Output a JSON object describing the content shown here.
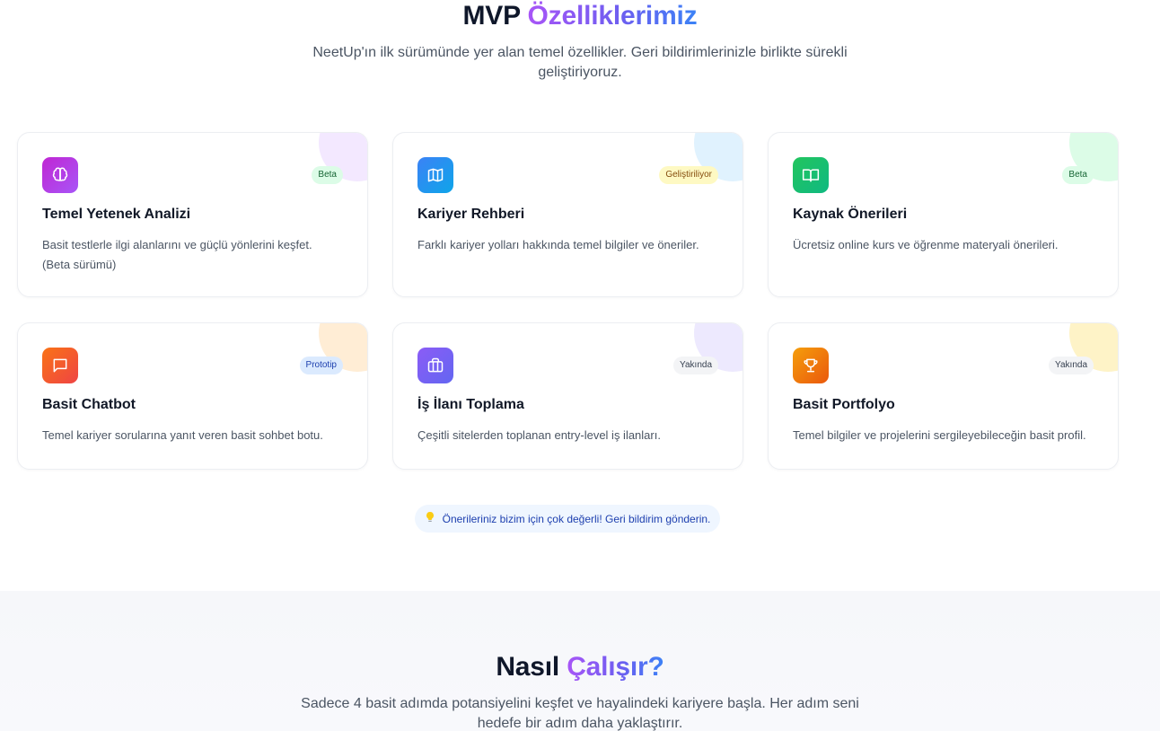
{
  "features": {
    "title_plain": "MVP",
    "title_accent": "Özelliklerimiz",
    "subtitle": "NeetUp'ın ilk sürümünde yer alan temel özellikler. Geri bildirimlerinizle birlikte sürekli geliştiriyoruz.",
    "cards": [
      {
        "title": "Temel Yetenek Analizi",
        "desc": "Basit testlerle ilgi alanlarını ve güçlü yönlerini keşfet. (Beta sürümü)",
        "badge": "Beta",
        "icon": "brain-icon"
      },
      {
        "title": "Kariyer Rehberi",
        "desc": "Farklı kariyer yolları hakkında temel bilgiler ve öneriler.",
        "badge": "Geliştiriliyor",
        "icon": "map-icon"
      },
      {
        "title": "Kaynak Önerileri",
        "desc": "Ücretsiz online kurs ve öğrenme materyali önerileri.",
        "badge": "Beta",
        "icon": "book-icon"
      },
      {
        "title": "Basit Chatbot",
        "desc": "Temel kariyer sorularına yanıt veren basit sohbet botu.",
        "badge": "Prototip",
        "icon": "chat-icon"
      },
      {
        "title": "İş İlanı Toplama",
        "desc": "Çeşitli sitelerden toplanan entry-level iş ilanları.",
        "badge": "Yakında",
        "icon": "briefcase-icon"
      },
      {
        "title": "Basit Portfolyo",
        "desc": "Temel bilgiler ve projelerini sergileyebileceğin basit profil.",
        "badge": "Yakında",
        "icon": "trophy-icon"
      }
    ],
    "feedback": {
      "icon": "lightbulb-icon",
      "text": "Önerileriniz bizim için çok değerli! Geri bildirim gönderin."
    }
  },
  "how": {
    "title_plain": "Nasıl",
    "title_accent": "Çalışır?",
    "subtitle": "Sadece 4 basit adımda potansiyelini keşfet ve hayalindeki kariyere başla. Her adım seni hedefe bir adım daha yaklaştırır."
  }
}
